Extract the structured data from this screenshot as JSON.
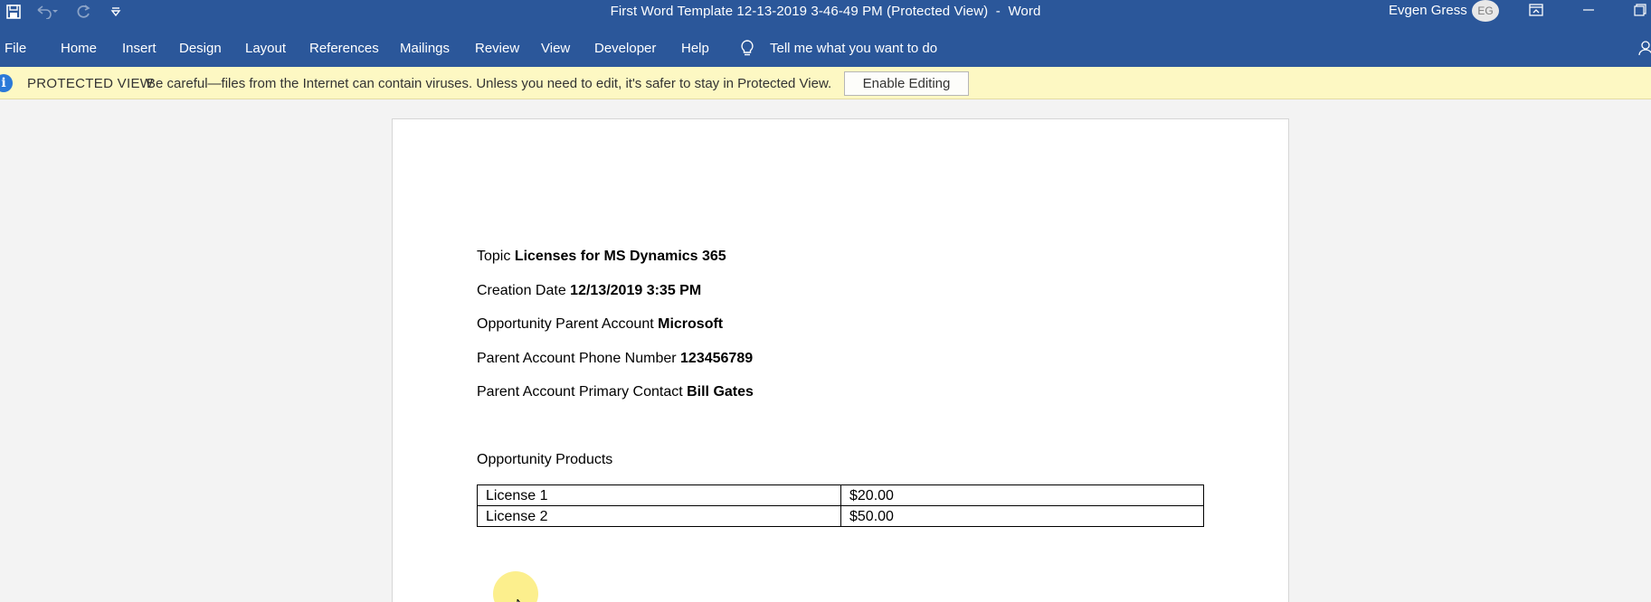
{
  "titlebar": {
    "doc_title": "First Word Template 12-13-2019 3-46-49 PM (Protected View)",
    "separator": "-",
    "app_name": "Word",
    "user_name": "Evgen Gress",
    "user_initials": "EG"
  },
  "ribbon": {
    "tabs": [
      "File",
      "Home",
      "Insert",
      "Design",
      "Layout",
      "References",
      "Mailings",
      "Review",
      "View",
      "Developer",
      "Help"
    ],
    "tell_me": "Tell me what you want to do"
  },
  "protected_view": {
    "title": "PROTECTED VIEW",
    "message": "Be careful—files from the Internet can contain viruses. Unless you need to edit, it's safer to stay in Protected View.",
    "button": "Enable Editing"
  },
  "document": {
    "fields": [
      {
        "label": "Topic",
        "value": "Licenses for MS Dynamics 365"
      },
      {
        "label": "Creation Date",
        "value": "12/13/2019 3:35 PM"
      },
      {
        "label": "Opportunity Parent Account",
        "value": "Microsoft"
      },
      {
        "label": "Parent Account Phone Number",
        "value": "123456789"
      },
      {
        "label": "Parent Account Primary Contact",
        "value": "Bill Gates"
      }
    ],
    "products_heading": "Opportunity Products",
    "products": [
      {
        "name": "License 1",
        "price": "$20.00"
      },
      {
        "name": "License 2",
        "price": "$50.00"
      }
    ]
  },
  "colors": {
    "title_bar": "#2b579a",
    "protected_bar": "#fdf8c3",
    "info_icon": "#2b79d8"
  }
}
